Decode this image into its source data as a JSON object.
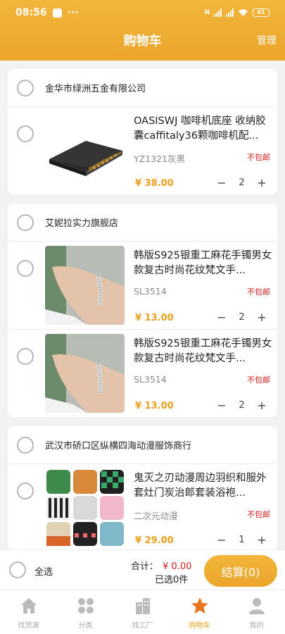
{
  "status_bar": {
    "time": "08:56",
    "more": "···",
    "battery": "41"
  },
  "nav": {
    "title": "购物车",
    "manage_label": "管理"
  },
  "stores": [
    {
      "name": "金华市绿洲五金有限公司",
      "items": [
        {
          "title": "OASISWJ 咖啡机底座 收纳胶囊caffitaly36颗咖啡机配...",
          "spec": "YZ1321灰黑",
          "shipping": "不包邮",
          "price": "¥ 38.00",
          "quantity": "2",
          "minus": "−",
          "plus": "+",
          "image": "coffee-capsule-drawer"
        }
      ]
    },
    {
      "name": "艾妮拉实力旗舰店",
      "items": [
        {
          "title": "韩版S925银重工麻花手镯男女款复古时尚花纹梵文手...",
          "spec": "SL3514",
          "shipping": "不包邮",
          "price": "¥ 13.00",
          "quantity": "2",
          "minus": "−",
          "plus": "+",
          "image": "silver-bracelet"
        },
        {
          "title": "韩版S925银重工麻花手镯男女款复古时尚花纹梵文手...",
          "spec": "SL3514",
          "shipping": "不包邮",
          "price": "¥ 13.00",
          "quantity": "2",
          "minus": "−",
          "plus": "+",
          "image": "silver-bracelet"
        }
      ]
    },
    {
      "name": "武汉市硚口区纵横四海动漫服饰商行",
      "items": [
        {
          "title": "鬼灭之刃动漫周边羽织和服外套灶门炭治郎套装浴袍...",
          "spec": "二次元动漫",
          "shipping": "不包邮",
          "price": "¥ 29.00",
          "quantity": "1",
          "minus": "−",
          "plus": "+",
          "image": "anime-haori-set"
        }
      ]
    }
  ],
  "checkout": {
    "select_all_label": "全选",
    "total_label": "合计：",
    "total_amount": "¥ 0.00",
    "selected_text": "已选0件",
    "button_label": "结算(0)"
  },
  "tabbar": [
    {
      "label": "找货源",
      "icon": "home-icon",
      "active": false
    },
    {
      "label": "分类",
      "icon": "category-icon",
      "active": false
    },
    {
      "label": "找工厂",
      "icon": "factory-icon",
      "active": false
    },
    {
      "label": "购物车",
      "icon": "star-cart-icon",
      "active": true
    },
    {
      "label": "我的",
      "icon": "user-icon",
      "active": false
    }
  ],
  "colors": {
    "brand": "#eea92f",
    "price": "#ee9f1b",
    "warning": "#d4201d",
    "inactive": "#bbbbbb"
  }
}
